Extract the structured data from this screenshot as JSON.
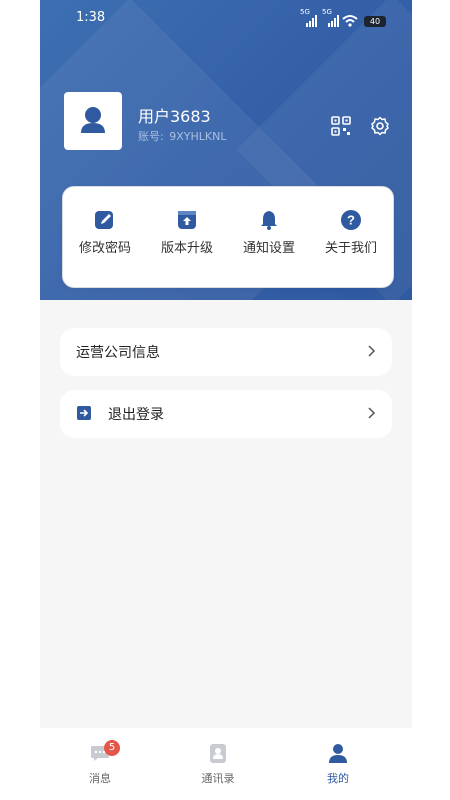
{
  "status_bar": {
    "time": "1:38",
    "signal1": "5G",
    "signal2": "5G",
    "battery": "40"
  },
  "profile": {
    "username": "用户3683",
    "account_label": "账号:",
    "account_id": "9XYHLKNL"
  },
  "icons": {
    "qr": "qr-code-icon",
    "settings": "gear-icon",
    "user": "user-avatar-icon"
  },
  "menu": [
    {
      "label": "修改密码",
      "icon": "edit-icon"
    },
    {
      "label": "版本升级",
      "icon": "upgrade-icon"
    },
    {
      "label": "通知设置",
      "icon": "bell-icon"
    },
    {
      "label": "关于我们",
      "icon": "help-icon"
    }
  ],
  "rows": [
    {
      "label": "运营公司信息",
      "icon": ""
    },
    {
      "label": "退出登录",
      "icon": "logout-icon"
    }
  ],
  "tabbar": [
    {
      "label": "消息",
      "icon": "message-icon",
      "badge": "5"
    },
    {
      "label": "通讯录",
      "icon": "contacts-icon"
    },
    {
      "label": "我的",
      "icon": "profile-icon",
      "active": true
    }
  ],
  "colors": {
    "brand": "#2f5aa0",
    "badge": "#e4564a"
  }
}
